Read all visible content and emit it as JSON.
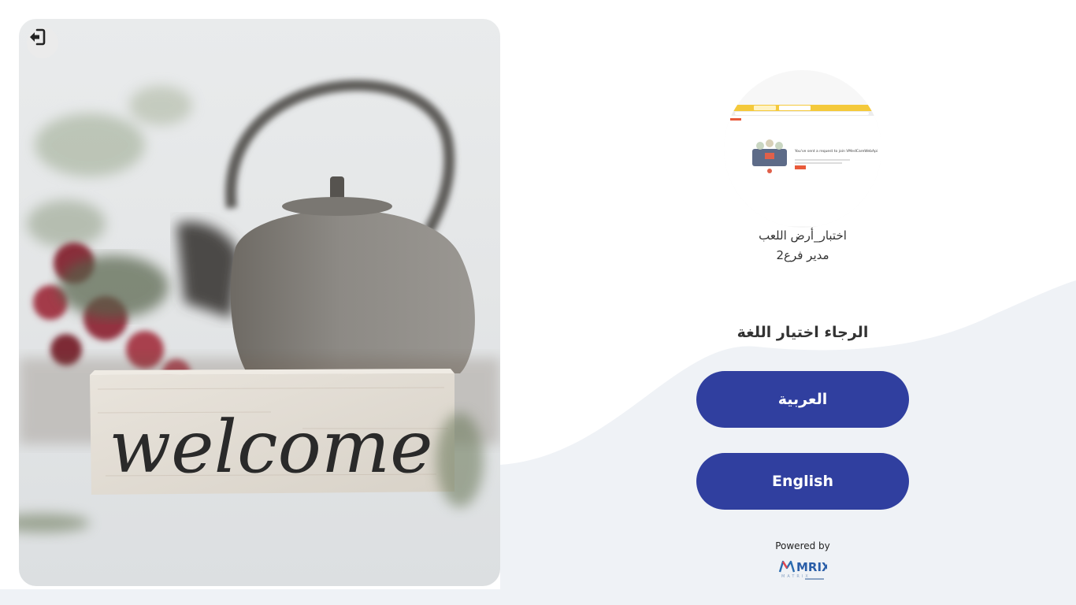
{
  "hero": {
    "sign_text": "welcome"
  },
  "header": {
    "logout_icon": "logout-icon"
  },
  "profile": {
    "name": "اختبار_أرض اللعب",
    "role": "مدير فرع2",
    "avatar_screenshot_title": "You've sent a request to join VMedCareWebApi"
  },
  "language": {
    "prompt": "الرجاء اختيار اللغة",
    "arabic_label": "العربية",
    "english_label": "English"
  },
  "footer": {
    "powered_by": "Powered by",
    "brand_name": "MRIX",
    "brand_sub": "MATRIX"
  },
  "colors": {
    "primary": "#303f9f",
    "wave": "#eff2f6"
  }
}
